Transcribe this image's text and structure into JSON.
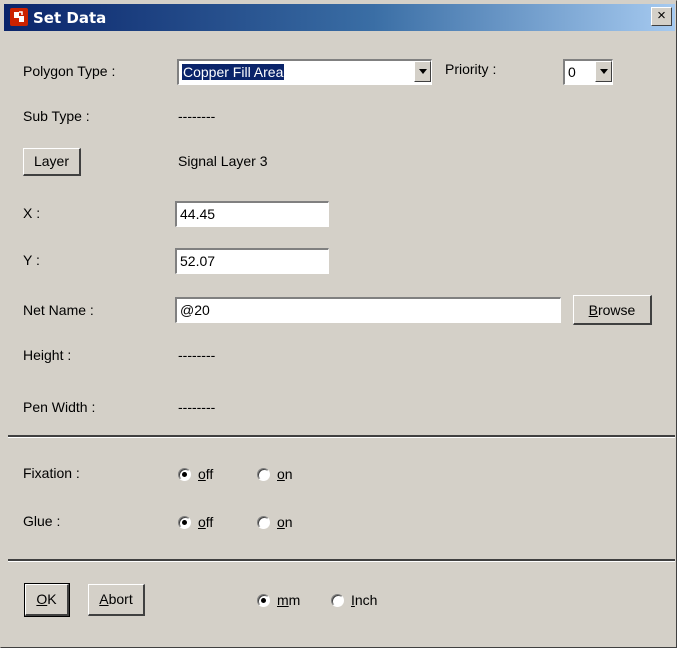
{
  "window": {
    "title": "Set Data",
    "close_label": "×"
  },
  "polygon_type": {
    "label": "Polygon Type :",
    "value": "Copper Fill Area"
  },
  "priority": {
    "label": "Priority :",
    "value": "0"
  },
  "sub_type": {
    "label": "Sub Type :",
    "value": "--------"
  },
  "layer": {
    "button_label": "Layer",
    "value": "Signal Layer 3"
  },
  "x": {
    "label": "X :",
    "value": "44.45"
  },
  "y": {
    "label": "Y :",
    "value": "52.07"
  },
  "net_name": {
    "label": "Net Name :",
    "value": "@20",
    "browse_first": "B",
    "browse_rest": "rowse"
  },
  "height": {
    "label": "Height :",
    "value": "--------"
  },
  "pen_width": {
    "label": "Pen Width :",
    "value": "--------"
  },
  "fixation": {
    "label": "Fixation :",
    "off_first": "o",
    "off_rest": "ff",
    "on_first": "o",
    "on_rest": "n",
    "selected": "off"
  },
  "glue": {
    "label": "Glue :",
    "off_first": "o",
    "off_rest": "ff",
    "on_first": "o",
    "on_rest": "n",
    "selected": "off"
  },
  "buttons": {
    "ok_first": "O",
    "ok_rest": "K",
    "abort_first": "A",
    "abort_rest": "bort"
  },
  "units": {
    "mm_first": "m",
    "mm_rest": "m",
    "inch_first": "I",
    "inch_rest": "nch",
    "selected": "mm"
  },
  "colors": {
    "title_start": "#0a246a",
    "title_end": "#a6caf0",
    "face": "#d4d0c8",
    "icon_red": "#cc2200"
  }
}
